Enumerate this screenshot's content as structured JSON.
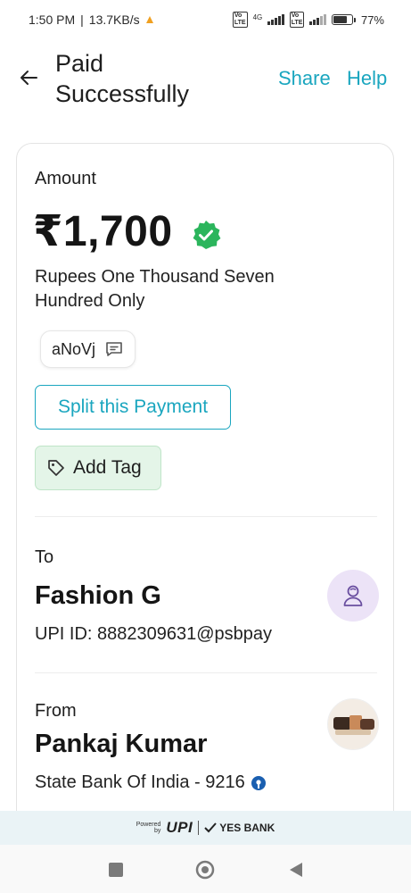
{
  "status_bar": {
    "time": "1:50 PM",
    "net_speed": "13.7KB/s",
    "network_type": "4G",
    "battery": "77%",
    "battery_level": 0.77,
    "icons": [
      "signal-icon",
      "volte-icon",
      "battery-icon"
    ]
  },
  "header": {
    "title": "Paid Successfully",
    "share_label": "Share",
    "help_label": "Help",
    "back_icon": "back-arrow-icon"
  },
  "payment": {
    "amount_label": "Amount",
    "amount": "₹1,700",
    "amount_in_words": "Rupees One Thousand Seven Hundred Only",
    "note": "aNoVj",
    "split_label": "Split this Payment",
    "tag_label": "Add Tag"
  },
  "recipient": {
    "label": "To",
    "name": "Fashion G",
    "upi_id": "UPI ID: 8882309631@psbpay"
  },
  "sender": {
    "label": "From",
    "name": "Pankaj Kumar",
    "account": "State Bank Of India - 9216"
  },
  "footer": {
    "powered_line1": "Powered",
    "powered_line2": "by",
    "upi_logo": "UPI",
    "bank": "YES BANK"
  },
  "colors": {
    "accent": "#1aa6bf",
    "verified_green": "#2bb55c",
    "tag_bg": "#e4f5e8",
    "avatar_bg": "#ece3f7"
  }
}
